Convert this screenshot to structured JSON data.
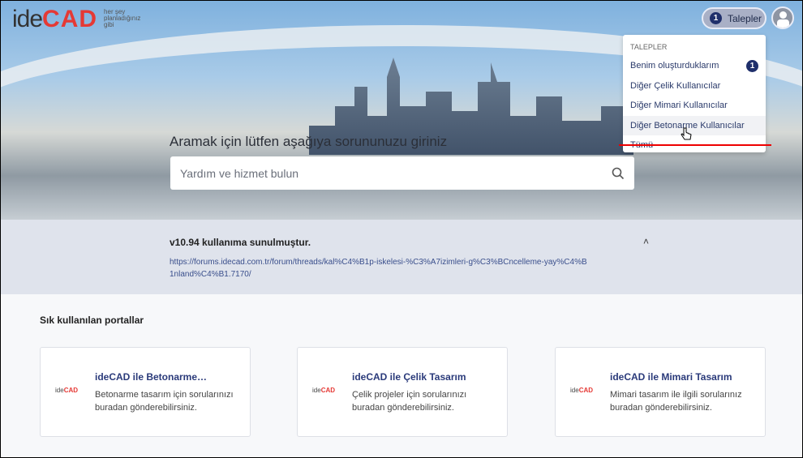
{
  "header": {
    "logo_ide": "ide",
    "logo_cad": "CAD",
    "logo_tagline": "her şey planladığınız gibi",
    "requests_label": "Talepler",
    "requests_count": "1"
  },
  "dropdown": {
    "heading": "TALEPLER",
    "items": [
      {
        "label": "Benim oluşturduklarım",
        "count": "1"
      },
      {
        "label": "Diğer Çelik Kullanıcılar"
      },
      {
        "label": "Diğer Mimari Kullanıcılar"
      },
      {
        "label": "Diğer Betonarme Kullanıcılar"
      },
      {
        "label": "Tümü"
      }
    ]
  },
  "search": {
    "title": "Aramak için lütfen aşağıya sorununuzu giriniz",
    "placeholder": "Yardım ve hizmet bulun"
  },
  "announcement": {
    "title": "v10.94 kullanıma sunulmuştur.",
    "link": "https://forums.idecad.com.tr/forum/threads/kal%C4%B1p-iskelesi-%C3%A7izimleri-g%C3%BCncelleme-yay%C4%B1nland%C4%B1.7170/"
  },
  "portals": {
    "heading": "Sık kullanılan portallar",
    "cards": [
      {
        "logo_ide": "ide",
        "logo_cad": "CAD",
        "title": "ideCAD ile Betonarme…",
        "desc": "Betonarme tasarım için sorularınızı buradan gönderebilirsiniz."
      },
      {
        "logo_ide": "ide",
        "logo_cad": "CAD",
        "title": "ideCAD ile Çelik Tasarım",
        "desc": "Çelik projeler için sorularınızı buradan gönderebilirsiniz."
      },
      {
        "logo_ide": "ide",
        "logo_cad": "CAD",
        "title": "ideCAD ile Mimari Tasarım",
        "desc": "Mimari tasarım ile ilgili sorularınız buradan gönderebilirsiniz."
      }
    ]
  }
}
